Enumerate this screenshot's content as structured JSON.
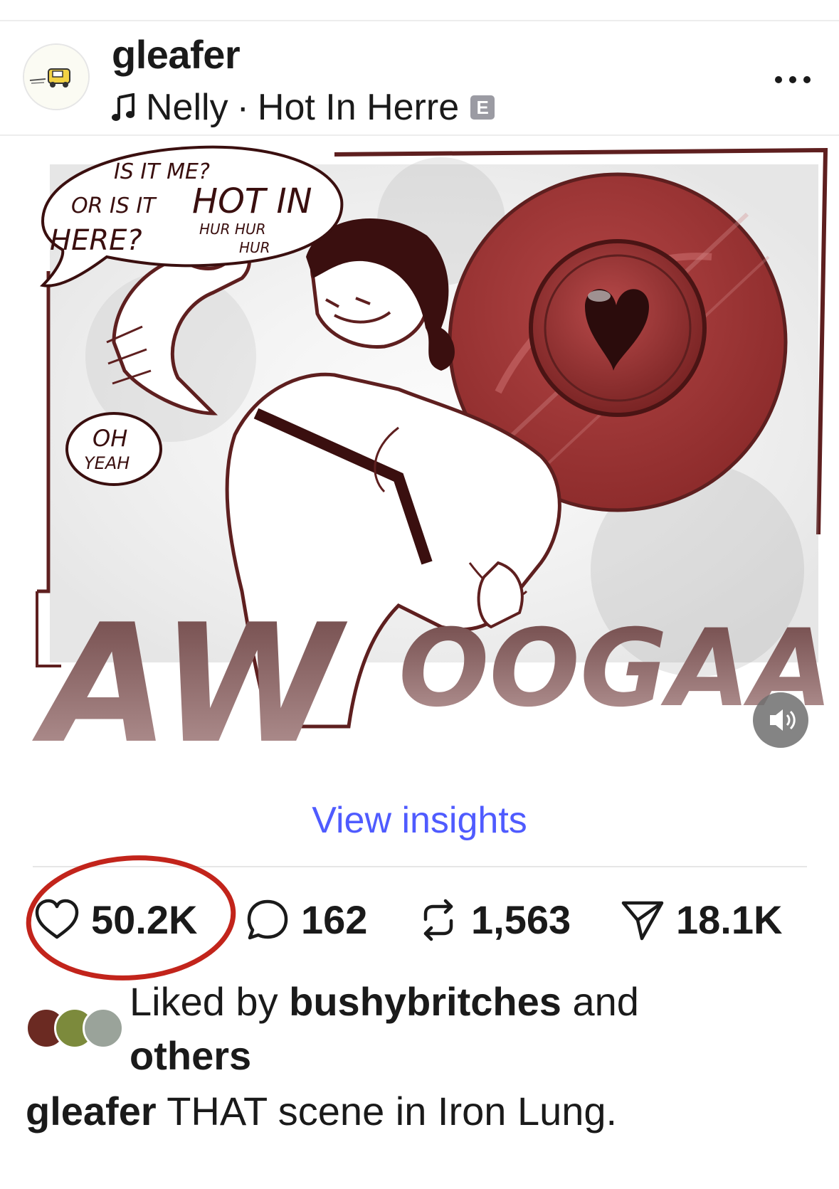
{
  "post": {
    "username": "gleafer",
    "music": {
      "artist": "Nelly",
      "separator": "·",
      "track": "Hot In Herre",
      "explicit_badge": "E"
    },
    "media": {
      "art_text": {
        "bubble_line1": "IS IT ME?",
        "bubble_line2": "OR IS IT",
        "bubble_line3": "HOT IN",
        "bubble_line4": "HERE?",
        "bubble_small1": "HUR HUR",
        "bubble_small2": "HUR",
        "small_bubble_line1": "OH",
        "small_bubble_line2": "YEAH",
        "big_left": "AW",
        "big_right": "OOGAA!"
      }
    },
    "insights_label": "View insights",
    "actions": {
      "likes": "50.2K",
      "comments": "162",
      "reposts": "1,563",
      "shares": "18.1K"
    },
    "liked_by": {
      "prefix": "Liked by",
      "user": "bushybritches",
      "and": "and",
      "suffix": "others"
    },
    "caption": {
      "author": "gleafer",
      "text": "THAT scene in Iron Lung."
    }
  },
  "colors": {
    "accent_link": "#4f5bff",
    "art_maroon": "#5e1f1f",
    "art_red": "#a83a3a",
    "highlight_circle": "#c2241b"
  },
  "icons": [
    "music-note-icon",
    "more-icon",
    "heart-icon",
    "comment-icon",
    "repost-icon",
    "share-icon",
    "volume-icon"
  ]
}
